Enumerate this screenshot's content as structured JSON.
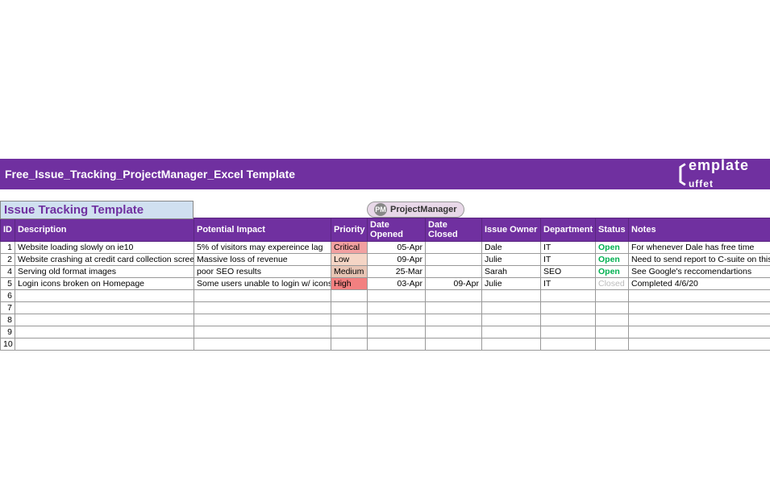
{
  "banner": {
    "title": "Free_Issue_Tracking_ProjectManager_Excel Template",
    "logo_text": "emplate",
    "logo_sub": "uffet"
  },
  "heading": "Issue Tracking Template",
  "pm_logo": "ProjectManager",
  "pm_badge": "PM",
  "headers": {
    "id": "ID",
    "description": "Description",
    "impact": "Potential Impact",
    "priority": "Priority",
    "opened": "Date Opened",
    "closed": "Date Closed",
    "owner": "Issue Owner",
    "department": "Department",
    "status": "Status",
    "notes": "Notes"
  },
  "rows": [
    {
      "id": "1",
      "description": "Website loading slowly on ie10",
      "impact": "5% of visitors may expereince lag",
      "priority": "Critical",
      "opened": "05-Apr",
      "closed": "",
      "owner": "Dale",
      "department": "IT",
      "status": "Open",
      "notes": "For whenever Dale has free time"
    },
    {
      "id": "2",
      "description": "Website crashing at credit card collection screen",
      "impact": "Massive loss of revenue",
      "priority": "Low",
      "opened": "09-Apr",
      "closed": "",
      "owner": "Julie",
      "department": "IT",
      "status": "Open",
      "notes": "Need to send report to C-suite on this"
    },
    {
      "id": "4",
      "description": "Serving old format images",
      "impact": "poor SEO results",
      "priority": "Medium",
      "opened": "25-Mar",
      "closed": "",
      "owner": "Sarah",
      "department": "SEO",
      "status": "Open",
      "notes": "See Google's reccomendartions"
    },
    {
      "id": "5",
      "description": "Login icons broken on Homepage",
      "impact": "Some users unable to login w/ icons",
      "priority": "High",
      "opened": "03-Apr",
      "closed": "09-Apr",
      "owner": "Julie",
      "department": "IT",
      "status": "Closed",
      "notes": "Completed 4/6/20"
    },
    {
      "id": "6",
      "description": "",
      "impact": "",
      "priority": "",
      "opened": "",
      "closed": "",
      "owner": "",
      "department": "",
      "status": "",
      "notes": ""
    },
    {
      "id": "7",
      "description": "",
      "impact": "",
      "priority": "",
      "opened": "",
      "closed": "",
      "owner": "",
      "department": "",
      "status": "",
      "notes": ""
    },
    {
      "id": "8",
      "description": "",
      "impact": "",
      "priority": "",
      "opened": "",
      "closed": "",
      "owner": "",
      "department": "",
      "status": "",
      "notes": ""
    },
    {
      "id": "9",
      "description": "",
      "impact": "",
      "priority": "",
      "opened": "",
      "closed": "",
      "owner": "",
      "department": "",
      "status": "",
      "notes": ""
    },
    {
      "id": "10",
      "description": "",
      "impact": "",
      "priority": "",
      "opened": "",
      "closed": "",
      "owner": "",
      "department": "",
      "status": "",
      "notes": ""
    }
  ]
}
